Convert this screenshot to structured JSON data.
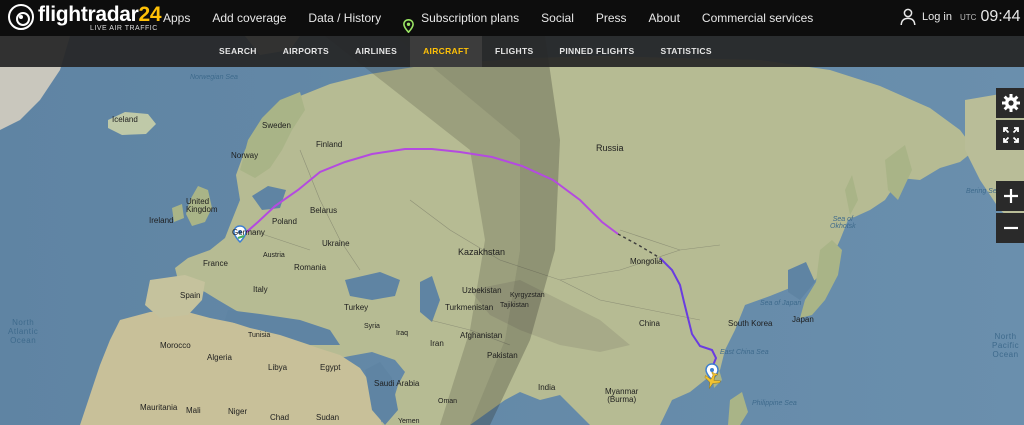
{
  "brand": {
    "logo_main": "flightradar",
    "logo_num": "24",
    "logo_sub": "LIVE AIR TRAFFIC"
  },
  "nav": {
    "items": [
      {
        "label": "Apps"
      },
      {
        "label": "Add coverage"
      },
      {
        "label": "Data / History"
      },
      {
        "label": "Subscription plans"
      },
      {
        "label": "Social"
      },
      {
        "label": "Press"
      },
      {
        "label": "About"
      },
      {
        "label": "Commercial services"
      }
    ],
    "login": "Log in",
    "utc_label": "UTC",
    "time": "09:44"
  },
  "subnav": {
    "tabs": [
      "SEARCH",
      "AIRPORTS",
      "AIRLINES",
      "AIRCRAFT",
      "FLIGHTS",
      "PINNED FLIGHTS",
      "STATISTICS"
    ],
    "active": "AIRCRAFT"
  },
  "colors": {
    "accent": "#ffc107",
    "route_flown": "#b44ae0",
    "route_planned": "#333333",
    "marker": "#3e7fd0",
    "aircraft": "#f2c230"
  },
  "map": {
    "labels": {
      "norwegian_sea": "Norwegian Sea",
      "iceland": "Iceland",
      "norway": "Norway",
      "sweden": "Sweden",
      "finland": "Finland",
      "united_kingdom": "United\nKingdom",
      "ireland": "Ireland",
      "germany": "Germany",
      "poland": "Poland",
      "belarus": "Belarus",
      "ukraine": "Ukraine",
      "france": "France",
      "austria": "Austria",
      "romania": "Romania",
      "spain": "Spain",
      "italy": "Italy",
      "turkey": "Turkey",
      "syria": "Syria",
      "iraq": "Iraq",
      "iran": "Iran",
      "libya": "Libya",
      "egypt": "Egypt",
      "saudi_arabia": "Saudi Arabia",
      "yemen": "Yemen",
      "mali": "Mali",
      "niger": "Niger",
      "chad": "Chad",
      "sudan": "Sudan",
      "mauritania": "Mauritania",
      "morocco": "Morocco",
      "algeria": "Algeria",
      "tunisia": "Tunisia",
      "kazakhstan": "Kazakhstan",
      "uzbekistan": "Uzbekistan",
      "turkmenistan": "Turkmenistan",
      "kyrgyzstan": "Kyrgyzstan",
      "tajikistan": "Tajikistan",
      "afghanistan": "Afghanistan",
      "pakistan": "Pakistan",
      "india": "India",
      "oman": "Oman",
      "russia": "Russia",
      "mongolia": "Mongolia",
      "china": "China",
      "myanmar": "Myanmar\n(Burma)",
      "south_korea": "South Korea",
      "japan": "Japan",
      "sea_of_japan": "Sea of Japan",
      "sea_of_okhotsk": "Sea of\nOkhotsk",
      "bering_sea": "Bering Sea",
      "east_china_sea": "East China Sea",
      "philippine_sea": "Philippine Sea",
      "north_atlantic_ocean": "North\nAtlantic\nOcean",
      "north_pacific_ocean": "North\nPacific\nOcean"
    }
  },
  "controls": {
    "settings": "gear-icon",
    "fullscreen": "expand-icon",
    "zoom_in": "plus-icon",
    "zoom_out": "minus-icon"
  }
}
